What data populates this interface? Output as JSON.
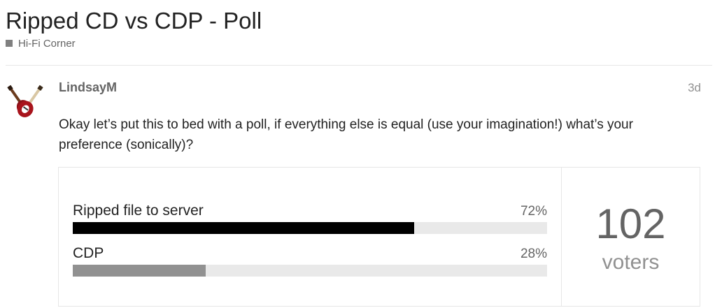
{
  "topic": {
    "title": "Ripped CD vs CDP - Poll",
    "category": {
      "name": "Hi-Fi Corner",
      "color": "#808080"
    }
  },
  "post": {
    "username": "LindsayM",
    "avatar_icon": "guitar-avatar-icon",
    "date": "3d",
    "body": "Okay let’s put this to bed with a poll, if everything else is equal (use your imagination!) what’s your preference (sonically)?"
  },
  "poll": {
    "options": [
      {
        "label": "Ripped file to server",
        "percent_text": "72%",
        "fraction": 0.72,
        "bar_color": "#000000"
      },
      {
        "label": "CDP",
        "percent_text": "28%",
        "fraction": 0.28,
        "bar_color": "#919191"
      }
    ],
    "voters": {
      "count": "102",
      "label": "voters"
    }
  },
  "colors": {
    "text_primary": "#222222",
    "text_secondary": "#646464",
    "text_muted": "#919191",
    "border": "#e6e6e6",
    "bar_track": "#e9e9e9"
  }
}
